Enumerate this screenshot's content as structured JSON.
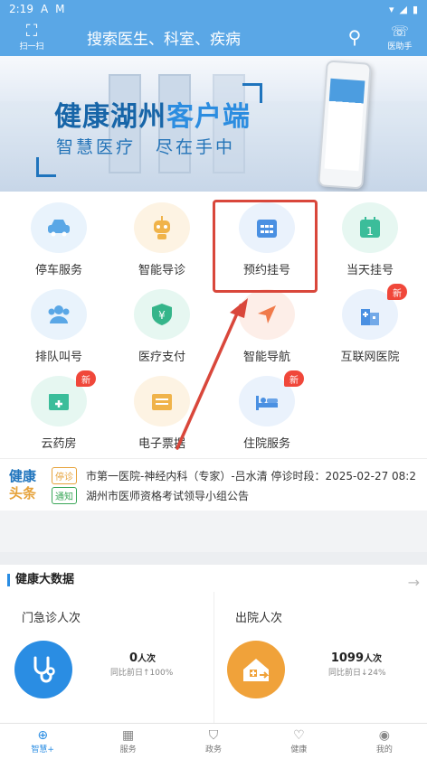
{
  "status_bar": {
    "time": "2:19",
    "icons_left": [
      "A",
      "M"
    ]
  },
  "header": {
    "scan_label": "扫一扫",
    "search_placeholder": "搜索医生、科室、疾病",
    "assistant_label": "医助手"
  },
  "banner": {
    "title_part1": "健康湖州",
    "title_part2": "客户端",
    "subtitle": "智慧医疗　尽在手中"
  },
  "services": [
    {
      "label": "停车服务",
      "icon": "car-icon",
      "color": "#5aa7e6",
      "bg": "#e9f3fc",
      "badge": ""
    },
    {
      "label": "智能导诊",
      "icon": "robot-icon",
      "color": "#f0b34a",
      "bg": "#fdf3e3",
      "badge": ""
    },
    {
      "label": "预约挂号",
      "icon": "calendar-icon",
      "color": "#4a90e2",
      "bg": "#eaf2fc",
      "badge": ""
    },
    {
      "label": "当天挂号",
      "icon": "calendar-today-icon",
      "color": "#3bbd9a",
      "bg": "#e6f7f1",
      "badge": ""
    },
    {
      "label": "排队叫号",
      "icon": "queue-icon",
      "color": "#5aa7e6",
      "bg": "#e9f3fc",
      "badge": ""
    },
    {
      "label": "医疗支付",
      "icon": "payment-icon",
      "color": "#35b58a",
      "bg": "#e6f7f1",
      "badge": ""
    },
    {
      "label": "智能导航",
      "icon": "navigation-icon",
      "color": "#f07a4a",
      "bg": "#fdeee8",
      "badge": ""
    },
    {
      "label": "互联网医院",
      "icon": "hospital-icon",
      "color": "#4a90e2",
      "bg": "#eaf2fc",
      "badge": "新"
    },
    {
      "label": "云药房",
      "icon": "pharmacy-icon",
      "color": "#3bbd9a",
      "bg": "#e6f7f1",
      "badge": "新"
    },
    {
      "label": "电子票据",
      "icon": "receipt-icon",
      "color": "#f0b34a",
      "bg": "#fdf3e3",
      "badge": ""
    },
    {
      "label": "住院服务",
      "icon": "inpatient-icon",
      "color": "#4a90e2",
      "bg": "#eaf2fc",
      "badge": "新"
    }
  ],
  "news": {
    "logo_line1": "健康",
    "logo_line2": "头条",
    "items": [
      {
        "tag": "停诊",
        "text": "市第一医院-神经内科（专家）-吕水清 停诊时段：2025-02-27 08:2"
      },
      {
        "tag": "通知",
        "text": "湖州市医师资格考试领导小组公告"
      }
    ]
  },
  "big_data": {
    "title": "健康大数据",
    "cards": [
      {
        "title": "门急诊人次",
        "value": "0",
        "unit": "人次",
        "compare": "同比前日↑100%",
        "icon": "stethoscope-icon",
        "color": "#2a8de3"
      },
      {
        "title": "出院人次",
        "value": "1099",
        "unit": "人次",
        "compare": "同比前日↓24%",
        "icon": "discharge-house-icon",
        "color": "#f0a23a"
      }
    ]
  },
  "tabs": [
    {
      "label": "智慧+",
      "icon": "plus-circle-icon",
      "active": true
    },
    {
      "label": "服务",
      "icon": "grid-icon",
      "active": false
    },
    {
      "label": "政务",
      "icon": "shield-icon",
      "active": false
    },
    {
      "label": "健康",
      "icon": "heart-pulse-icon",
      "active": false
    },
    {
      "label": "我的",
      "icon": "user-icon",
      "active": false
    }
  ]
}
